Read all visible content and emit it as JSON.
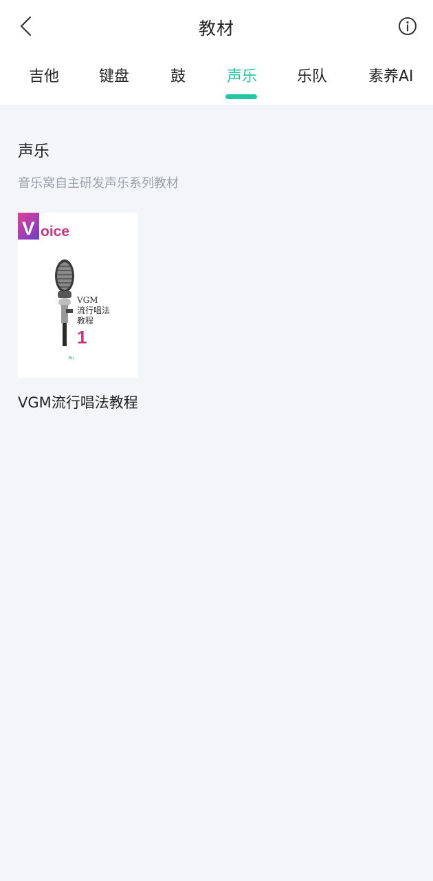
{
  "header": {
    "title": "教材",
    "back_icon": "back-icon",
    "info_icon": "info-icon"
  },
  "tabs": [
    {
      "label": "吉他",
      "active": false
    },
    {
      "label": "键盘",
      "active": false
    },
    {
      "label": "鼓",
      "active": false
    },
    {
      "label": "声乐",
      "active": true
    },
    {
      "label": "乐队",
      "active": false
    },
    {
      "label": "素养AI",
      "active": false
    }
  ],
  "section": {
    "title": "声乐",
    "subtitle": "音乐窝自主研发声乐系列教材"
  },
  "books": [
    {
      "title": "VGM流行唱法教程",
      "cover": {
        "logo_v": "V",
        "logo_rest": "oice",
        "line1": "VGM",
        "line2": "流行唱法",
        "line3": "教程",
        "number": "1",
        "publisher": "Bu"
      }
    }
  ],
  "colors": {
    "accent": "#1fc7a3",
    "background": "#f3f5f9",
    "subtitle": "#9aa0a8",
    "cover_pink": "#c8357f"
  }
}
